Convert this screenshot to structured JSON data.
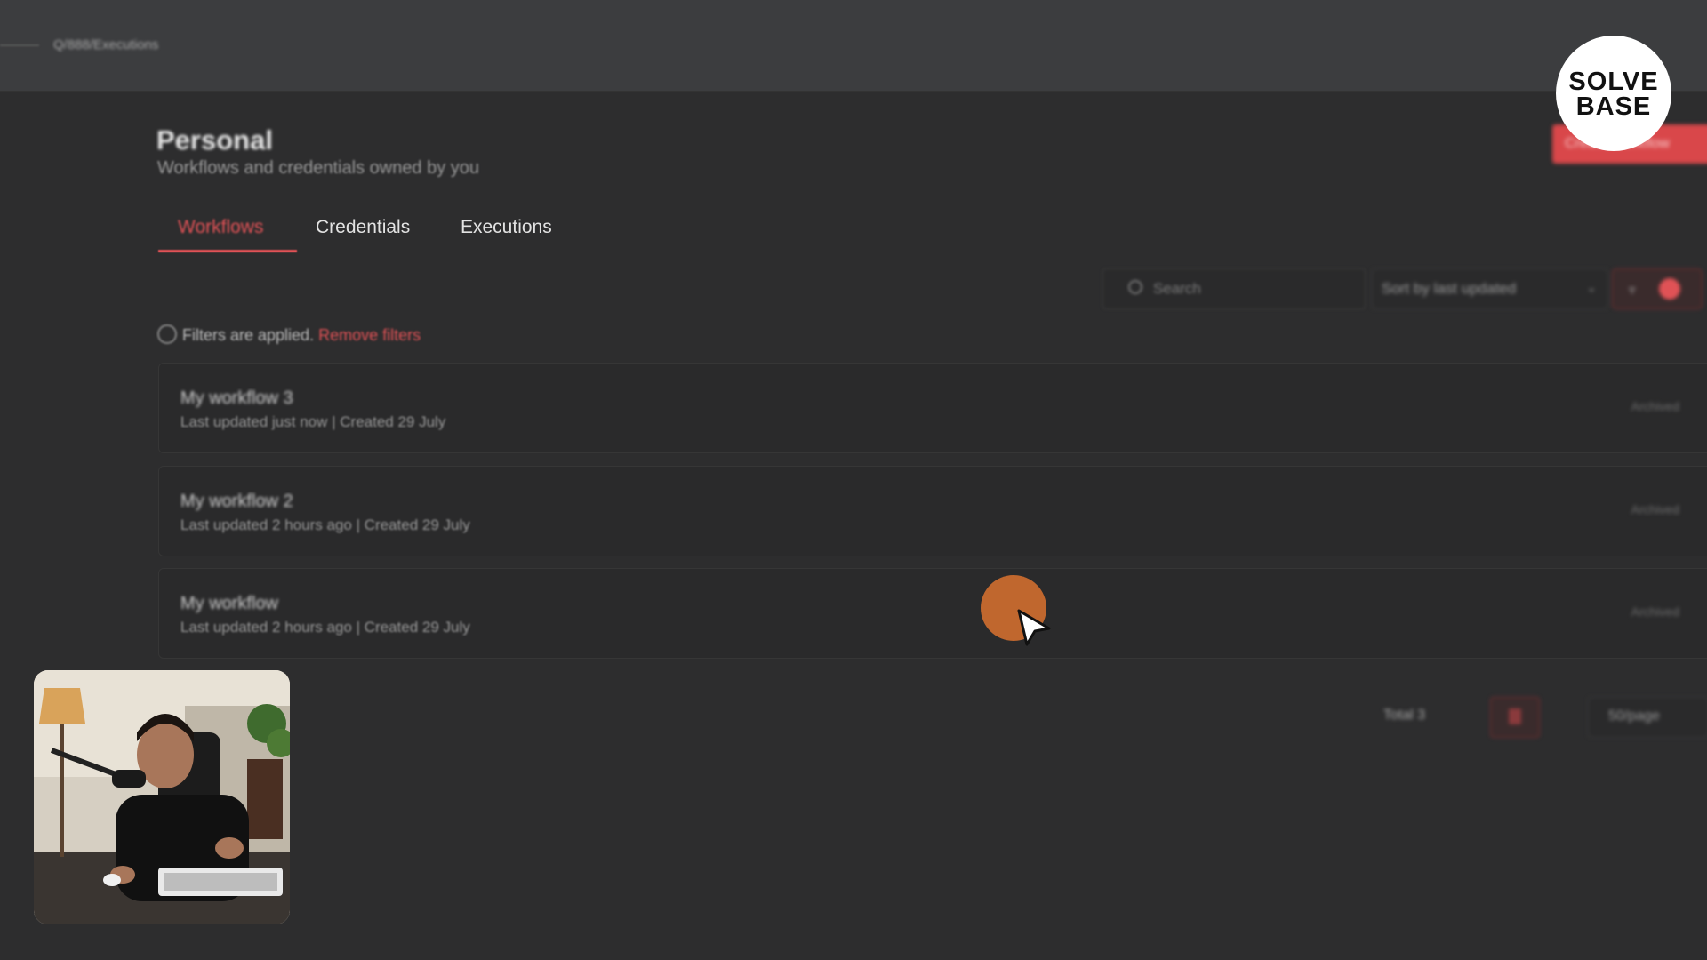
{
  "topbar": {
    "breadcrumb": "Q/888/Executions"
  },
  "header": {
    "title": "Personal",
    "subtitle": "Workflows and credentials owned by you",
    "create_button": "Create Workflow"
  },
  "tabs": [
    {
      "label": "Workflows",
      "active": true
    },
    {
      "label": "Credentials",
      "active": false
    },
    {
      "label": "Executions",
      "active": false
    }
  ],
  "toolbar": {
    "search_placeholder": "Search",
    "sort_label": "Sort by last updated",
    "filter_count": "1"
  },
  "filters": {
    "notice": "Filters are applied.",
    "remove_link": "Remove filters"
  },
  "workflows": [
    {
      "name": "My workflow 3",
      "meta": "Last updated just now | Created 29 July",
      "status": "Archived"
    },
    {
      "name": "My workflow 2",
      "meta": "Last updated 2 hours ago | Created 29 July",
      "status": "Archived"
    },
    {
      "name": "My workflow",
      "meta": "Last updated 2 hours ago | Created 29 July",
      "status": "Archived"
    }
  ],
  "pagination": {
    "total": "Total 3",
    "page_size": "50/page"
  },
  "logo": {
    "line1": "SOLVE",
    "line2": "BASE"
  },
  "colors": {
    "accent": "#e05256",
    "background": "#2d2d2e",
    "topbar": "#3c3d3f",
    "cursor_highlight": "#c0672e"
  }
}
